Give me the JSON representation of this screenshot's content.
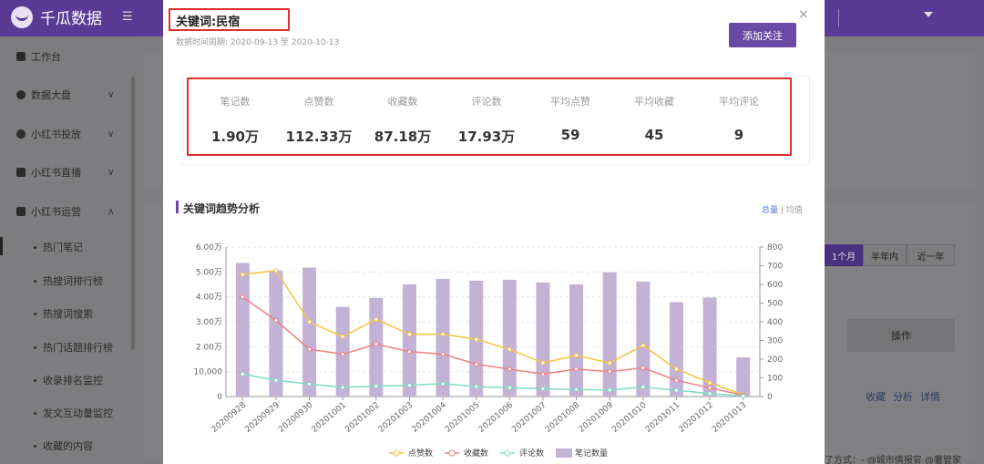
{
  "app": {
    "logo_text": "千瓜数据"
  },
  "sidebar": {
    "items": [
      {
        "label": "工作台"
      },
      {
        "label": "数据大盘"
      },
      {
        "label": "小红书投放"
      },
      {
        "label": "小红书直播"
      },
      {
        "label": "小红书运营"
      }
    ],
    "subitems": [
      {
        "label": "热门笔记"
      },
      {
        "label": "热搜词排行榜"
      },
      {
        "label": "热搜词搜索"
      },
      {
        "label": "热门话题排行榜"
      },
      {
        "label": "收录排名监控"
      },
      {
        "label": "发文互动量监控"
      },
      {
        "label": "收藏的内容"
      }
    ]
  },
  "background": {
    "period_buttons": [
      "1个月",
      "半年内",
      "近一年"
    ],
    "table_header": "操作",
    "row_links": [
      "收藏",
      "分析",
      "详情"
    ],
    "footer_text": "了方式：- @城市情报官 @薯管家"
  },
  "modal": {
    "title": "关键词:民宿",
    "date_range": "数据时间周期: 2020-09-13 至 2020-10-13",
    "follow_button": "添加关注",
    "close_icon": "×",
    "stats": [
      {
        "label": "笔记数",
        "value": "1.90万"
      },
      {
        "label": "点赞数",
        "value": "112.33万"
      },
      {
        "label": "收藏数",
        "value": "87.18万"
      },
      {
        "label": "评论数",
        "value": "17.93万"
      },
      {
        "label": "平均点赞",
        "value": "59"
      },
      {
        "label": "平均收藏",
        "value": "45"
      },
      {
        "label": "平均评论",
        "value": "9"
      }
    ],
    "section_title": "关键词趋势分析",
    "toggle": {
      "total": "总量",
      "avg": "均值",
      "sep": "|"
    }
  },
  "colors": {
    "brand": "#6b4aa6",
    "bars": "#c3b1d6",
    "likes": "#f6c342",
    "collects": "#f08080",
    "comments": "#7fdcc4"
  },
  "chart_data": {
    "type": "bar",
    "categories": [
      "20200928",
      "20200929",
      "20200930",
      "20201001",
      "20201002",
      "20201003",
      "20201004",
      "20201005",
      "20201006",
      "20201007",
      "20201008",
      "20201009",
      "20201010",
      "20201011",
      "20201012",
      "20201013"
    ],
    "left_axis": {
      "ticks": [
        "0",
        "10,000",
        "2.00万",
        "3.00万",
        "4.00万",
        "5.00万",
        "6.00万"
      ],
      "ylim": [
        0,
        60000
      ]
    },
    "right_axis": {
      "ticks": [
        "0",
        "100",
        "200",
        "300",
        "400",
        "500",
        "600",
        "700",
        "800"
      ],
      "ylim": [
        0,
        800
      ]
    },
    "series": [
      {
        "name": "点赞数",
        "kind": "line",
        "axis": "left",
        "color": "#f6c342",
        "values": [
          49000,
          50500,
          30000,
          24000,
          31000,
          25000,
          25000,
          23000,
          19000,
          13500,
          16500,
          13500,
          20500,
          11000,
          5500,
          700
        ]
      },
      {
        "name": "收藏数",
        "kind": "line",
        "axis": "left",
        "color": "#f08080",
        "values": [
          40000,
          30500,
          19000,
          17000,
          21000,
          18000,
          17000,
          13000,
          11000,
          9000,
          11000,
          10000,
          11500,
          6500,
          3500,
          500
        ]
      },
      {
        "name": "评论数",
        "kind": "line",
        "axis": "left",
        "color": "#7fdcc4",
        "values": [
          9000,
          6500,
          5000,
          3700,
          4200,
          4500,
          5200,
          4000,
          3500,
          3100,
          2800,
          2600,
          3800,
          2500,
          1200,
          200
        ]
      },
      {
        "name": "笔记数量",
        "kind": "bar",
        "axis": "right",
        "color": "#c3b1d6",
        "values": [
          715,
          675,
          690,
          480,
          528,
          600,
          630,
          620,
          625,
          610,
          600,
          665,
          615,
          505,
          530,
          210
        ]
      }
    ],
    "legend_position": "bottom-center",
    "grid": true
  }
}
